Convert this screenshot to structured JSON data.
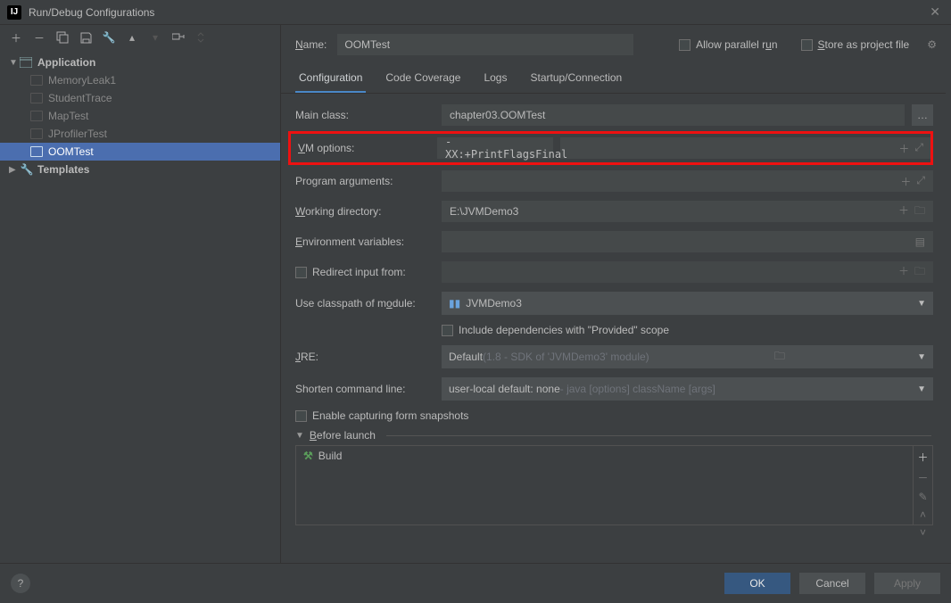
{
  "window": {
    "title": "Run/Debug Configurations"
  },
  "sidebar": {
    "application_label": "Application",
    "templates_label": "Templates",
    "items": [
      "MemoryLeak1",
      "StudentTrace",
      "MapTest",
      "JProfilerTest",
      "OOMTest"
    ]
  },
  "header": {
    "name_label": "Name:",
    "name_value": "OOMTest",
    "allow_parallel": "Allow parallel run",
    "store_project": "Store as project file"
  },
  "tabs": [
    "Configuration",
    "Code Coverage",
    "Logs",
    "Startup/Connection"
  ],
  "form": {
    "main_class_label": "Main class:",
    "main_class_value": "chapter03.OOMTest",
    "vm_label": "VM options:",
    "vm_value": "-XX:+PrintFlagsFinal",
    "prog_args_label": "Program arguments:",
    "work_dir_label": "Working directory:",
    "work_dir_value": "E:\\JVMDemo3",
    "env_label": "Environment variables:",
    "redirect_label": "Redirect input from:",
    "classpath_label": "Use classpath of module:",
    "classpath_value": "JVMDemo3",
    "include_deps": "Include dependencies with \"Provided\" scope",
    "jre_label": "JRE:",
    "jre_value": "Default",
    "jre_hint": " (1.8 - SDK of 'JVMDemo3' module)",
    "shorten_label": "Shorten command line:",
    "shorten_value": "user-local default: none",
    "shorten_hint": " - java [options] className [args]",
    "enable_snapshots": "Enable capturing form snapshots"
  },
  "before": {
    "label": "Before launch",
    "build": "Build"
  },
  "footer": {
    "ok": "OK",
    "cancel": "Cancel",
    "apply": "Apply"
  }
}
